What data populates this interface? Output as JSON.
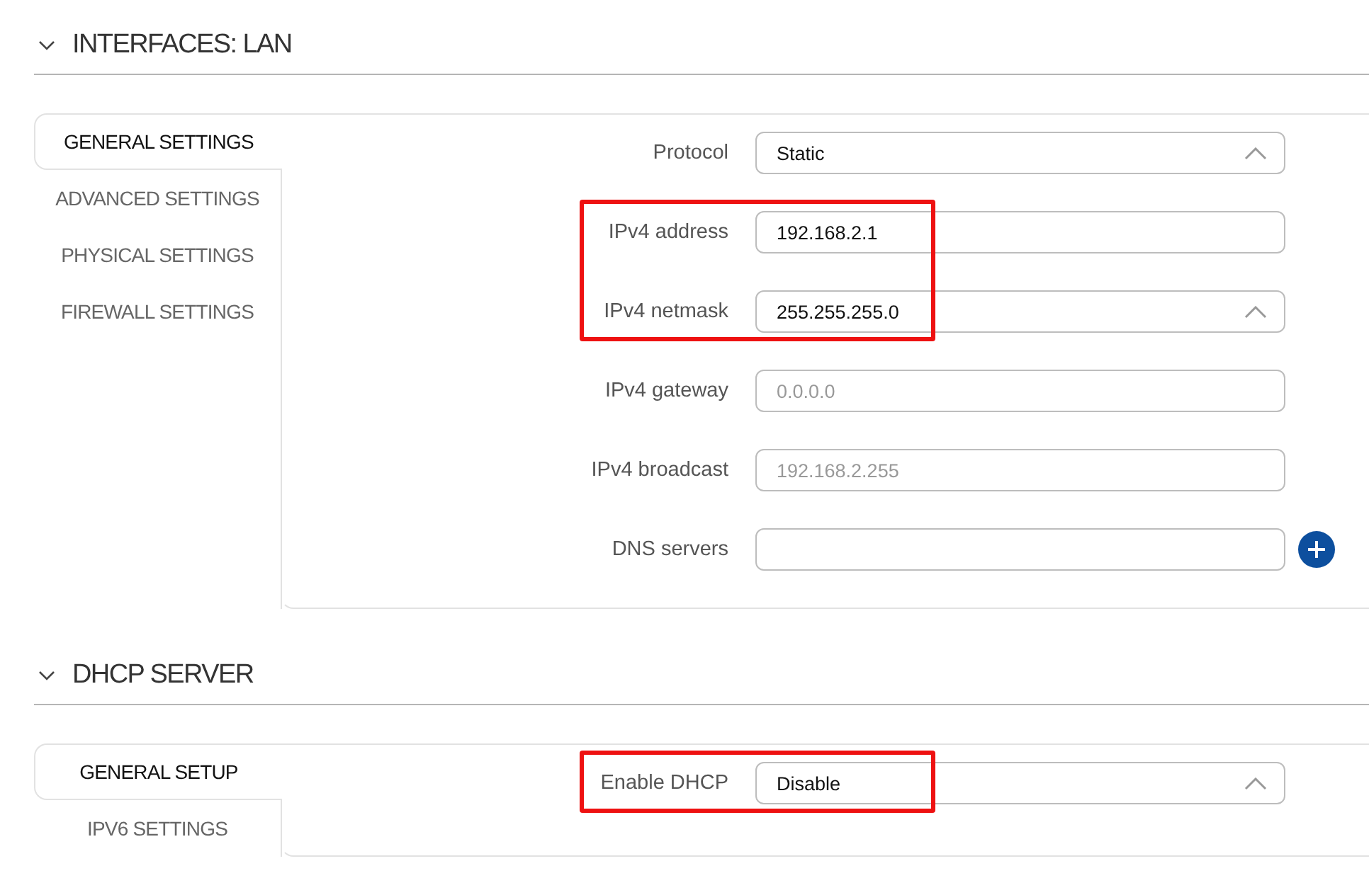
{
  "sections": [
    {
      "title": "INTERFACES: LAN",
      "expanded": true,
      "tabs": [
        {
          "label": "GENERAL SETTINGS",
          "selected": true
        },
        {
          "label": "ADVANCED SETTINGS",
          "selected": false
        },
        {
          "label": "PHYSICAL SETTINGS",
          "selected": false
        },
        {
          "label": "FIREWALL SETTINGS",
          "selected": false
        }
      ],
      "fields": [
        {
          "kind": "select",
          "label": "Protocol",
          "value": "Static",
          "highlighted": false
        },
        {
          "kind": "input",
          "label": "IPv4 address",
          "value": "192.168.2.1",
          "highlighted": true
        },
        {
          "kind": "select",
          "label": "IPv4 netmask",
          "value": "255.255.255.0",
          "highlighted": true
        },
        {
          "kind": "input",
          "label": "IPv4 gateway",
          "placeholder": "0.0.0.0",
          "highlighted": false
        },
        {
          "kind": "input",
          "label": "IPv4 broadcast",
          "placeholder": "192.168.2.255",
          "highlighted": false
        },
        {
          "kind": "input-add",
          "label": "DNS servers",
          "highlighted": false
        }
      ]
    },
    {
      "title": "DHCP SERVER",
      "expanded": true,
      "tabs": [
        {
          "label": "GENERAL SETUP",
          "selected": true
        },
        {
          "label": "IPV6 SETTINGS",
          "selected": false
        }
      ],
      "fields": [
        {
          "kind": "select",
          "label": "Enable DHCP",
          "value": "Disable",
          "highlighted": true
        }
      ]
    }
  ]
}
